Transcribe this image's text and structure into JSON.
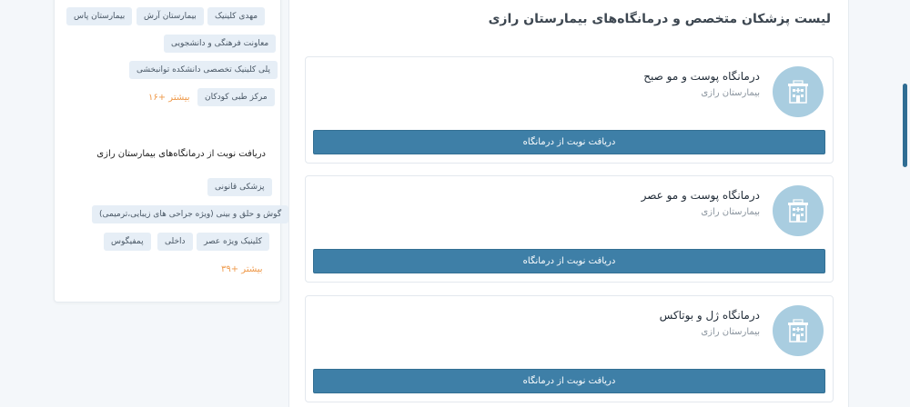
{
  "sidebar": {
    "hospital_tags": [
      {
        "label": "مهدی کلینیک"
      },
      {
        "label": "بیمارستان آرش"
      },
      {
        "label": "بیمارستان پاس"
      },
      {
        "label": "معاونت فرهنگی و دانشجویی"
      },
      {
        "label": "پلی کلینیک تخصصی دانشکده توانبخشی"
      },
      {
        "label": "مرکز طبی کودکان"
      }
    ],
    "hospital_more": "بیشتر +۱۶",
    "clinics_title": "دریافت نوبت از درمانگاه‌های بیمارستان رازی",
    "clinic_tags": [
      {
        "label": "پزشکی قانونی"
      },
      {
        "label": "گوش و حلق و بینی (ویژه جراحی های زیبایی،ترمیمی)"
      },
      {
        "label": "کلینیک ویژه عصر"
      },
      {
        "label": "داخلی"
      },
      {
        "label": "پمفیگوس"
      }
    ],
    "clinics_more": "بیشتر +۳۹"
  },
  "main": {
    "title": "لیست پزشکان متخصص و درمانگاه‌های بیمارستان رازی",
    "cards": [
      {
        "name": "درمانگاه پوست و مو صبح",
        "hospital": "بیمارستان رازی",
        "button": "دریافت نوبت از درمانگاه"
      },
      {
        "name": "درمانگاه پوست و مو عصر",
        "hospital": "بیمارستان رازی",
        "button": "دریافت نوبت از درمانگاه"
      },
      {
        "name": "درمانگاه ژل و بوتاکس",
        "hospital": "بیمارستان رازی",
        "button": "دریافت نوبت از درمانگاه"
      }
    ]
  },
  "colors": {
    "button": "#3e7fa7",
    "tag_bg": "#e6eef6",
    "more_link": "#ef9a4b",
    "avatar_bg": "#a9cde0"
  },
  "icons": {
    "clinic_avatar": "hospital-building-icon"
  }
}
